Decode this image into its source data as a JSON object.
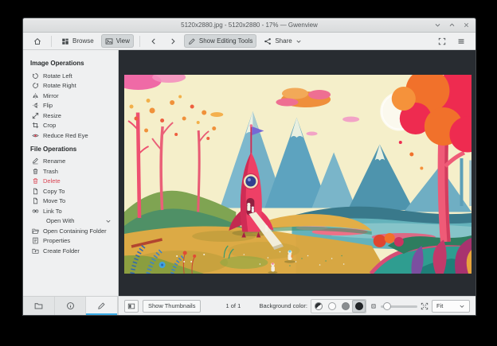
{
  "titlebar": {
    "title": "5120x2880.jpg - 5120x2880 - 17% — Gwenview"
  },
  "toolbar": {
    "browse": "Browse",
    "view": "View",
    "show_editing_tools": "Show Editing Tools",
    "share": "Share"
  },
  "sidebar": {
    "sections": [
      {
        "title": "Image Operations",
        "items": [
          {
            "label": "Rotate Left",
            "icon": "rotate-left"
          },
          {
            "label": "Rotate Right",
            "icon": "rotate-right"
          },
          {
            "label": "Mirror",
            "icon": "mirror"
          },
          {
            "label": "Flip",
            "icon": "flip"
          },
          {
            "label": "Resize",
            "icon": "resize"
          },
          {
            "label": "Crop",
            "icon": "crop"
          },
          {
            "label": "Reduce Red Eye",
            "icon": "red-eye"
          }
        ]
      },
      {
        "title": "File Operations",
        "items": [
          {
            "label": "Rename",
            "icon": "rename"
          },
          {
            "label": "Trash",
            "icon": "trash"
          },
          {
            "label": "Delete",
            "icon": "trash"
          },
          {
            "label": "Copy To",
            "icon": "copy"
          },
          {
            "label": "Move To",
            "icon": "copy"
          },
          {
            "label": "Link To",
            "icon": "link"
          },
          {
            "label": "Open With",
            "icon": "chevron-down"
          },
          {
            "label": "Open Containing Folder",
            "icon": "folder-open"
          },
          {
            "label": "Properties",
            "icon": "properties"
          },
          {
            "label": "Create Folder",
            "icon": "folder-new"
          }
        ]
      }
    ]
  },
  "statusbar": {
    "show_thumbnails": "Show Thumbnails",
    "counter": "1 of 1",
    "background_label": "Background color:",
    "fit": "Fit",
    "background_swatches": [
      "auto",
      "white",
      "gray",
      "black"
    ],
    "selected_swatch": "black"
  },
  "icons": {
    "home": "home",
    "browse": "grid",
    "view": "image",
    "back": "chevron-left",
    "forward": "chevron-right",
    "editing": "pencil",
    "share": "share",
    "dropdown": "chevron-down",
    "fullscreen": "fullscreen",
    "menu": "menu",
    "minimize": "chevron-down",
    "maximize": "chevron-up",
    "close": "close",
    "tab_folder": "folder",
    "tab_info": "info",
    "tab_edit": "pencil",
    "thumbnail_bar": "thumb-bar",
    "zoom_out": "zoom-small",
    "zoom_in": "zoom-expand"
  },
  "colors": {
    "accent": "#3daee9",
    "danger": "#da4453",
    "viewer_bg": "#282c31"
  }
}
